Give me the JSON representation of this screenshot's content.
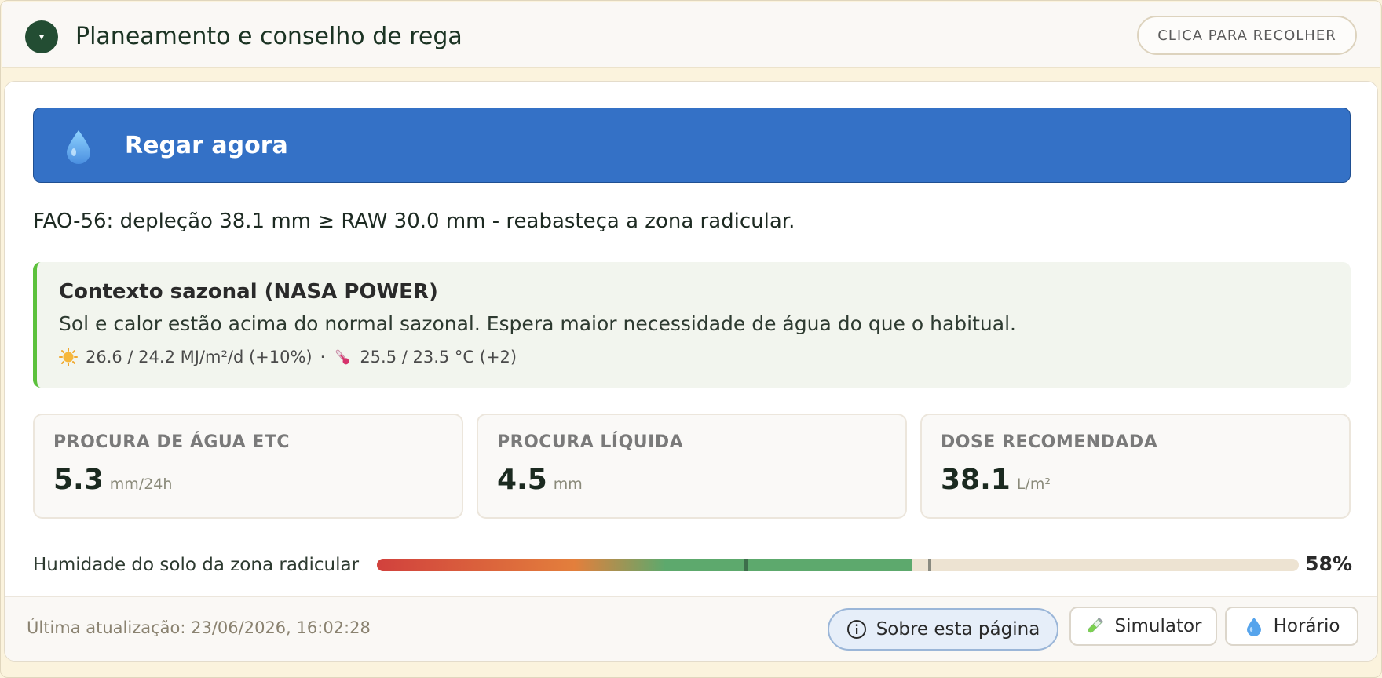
{
  "header": {
    "toggle_glyph": "▾",
    "title": "Planeamento e conselho de rega",
    "collapse_label": "CLICA PARA RECOLHER"
  },
  "banner": {
    "label": "Regar agora",
    "icon": "water-drop-icon",
    "color": "#3471c6"
  },
  "advice": {
    "text": "FAO-56: depleção 38.1 mm ≥ RAW 30.0 mm - reabasteça a zona radicular."
  },
  "season": {
    "title": "Contexto sazonal (NASA POWER)",
    "description": "Sol e calor estão acima do normal sazonal. Espera maior necessidade de água do que o habitual.",
    "radiation": "26.6 / 24.2 MJ/m²/d (+10%)",
    "separator": "·",
    "temperature": "25.5 / 23.5 °C (+2)",
    "accent_color": "#5cc13c"
  },
  "stats": [
    {
      "label": "PROCURA DE ÁGUA ETC",
      "value": "5.3",
      "unit": "mm/24h"
    },
    {
      "label": "PROCURA LÍQUIDA",
      "value": "4.5",
      "unit": "mm"
    },
    {
      "label": "DOSE RECOMENDADA",
      "value": "38.1",
      "unit": "L/m²"
    }
  ],
  "moisture": {
    "label": "Humidade do solo da zona radicular",
    "percent": 58,
    "percent_label": "58%",
    "tick_markers": [
      40,
      60
    ]
  },
  "footer": {
    "updated": "Última atualização: 23/06/2026, 16:02:28",
    "about_label": "Sobre esta página",
    "simulator_label": "Simulator",
    "schedule_label": "Horário"
  }
}
